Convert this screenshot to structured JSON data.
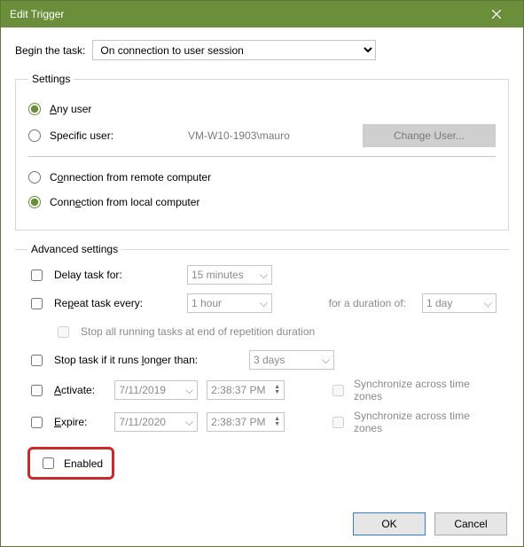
{
  "window": {
    "title": "Edit Trigger"
  },
  "begin": {
    "label": "Begin the task:",
    "selected": "On connection to user session"
  },
  "settings": {
    "legend": "Settings",
    "any_user": {
      "label_pre": "A",
      "label_rest": "ny user"
    },
    "specific_user": {
      "label": "Specific user:",
      "value": "VM-W10-1903\\mauro"
    },
    "change_user_button": "Change User...",
    "remote_label_pre": "C",
    "remote_label_u": "o",
    "remote_label_rest": "nnection from remote computer",
    "local_label_pre": "Conn",
    "local_label_u": "e",
    "local_label_rest": "ction from local computer"
  },
  "advanced": {
    "legend": "Advanced settings",
    "delay": {
      "label": "Delay task for:",
      "value": "15 minutes"
    },
    "repeat": {
      "label_pre": "Re",
      "label_u": "p",
      "label_rest": "eat task every:",
      "value": "1 hour",
      "duration_label": "for a duration of:",
      "duration_value": "1 day"
    },
    "stop_rep": {
      "label": "Stop all running tasks at end of repetition duration"
    },
    "stop_long": {
      "label_pre": "Stop task if it runs ",
      "label_u": "l",
      "label_rest": "onger than:",
      "value": "3 days"
    },
    "activate": {
      "label_u": "A",
      "label_rest": "ctivate:",
      "date": "7/11/2019",
      "time": "2:38:37 PM"
    },
    "expire": {
      "label_u": "E",
      "label_rest": "xpire:",
      "date": "7/11/2020",
      "time": "2:38:37 PM"
    },
    "sync": {
      "label": "Synchronize across time zones"
    },
    "enabled": {
      "label": "Enabled"
    }
  },
  "footer": {
    "ok": "OK",
    "cancel": "Cancel"
  }
}
